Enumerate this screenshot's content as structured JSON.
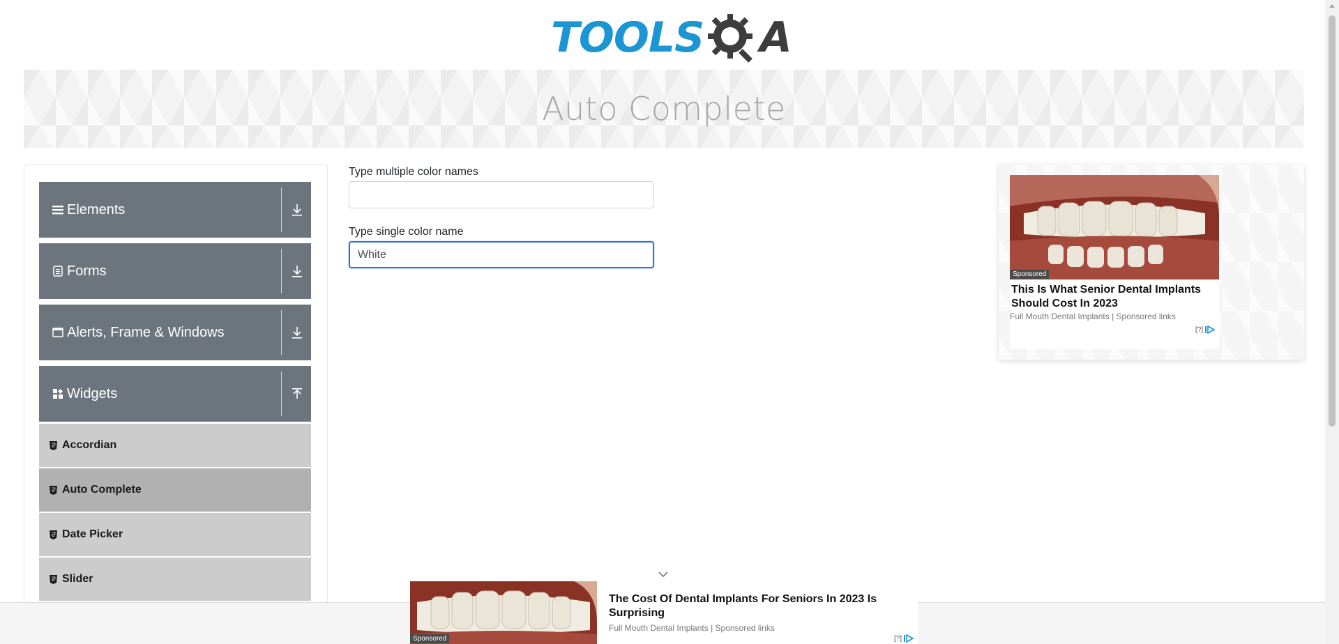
{
  "logo": {
    "part1": "TOOLS",
    "part2": "A"
  },
  "banner": {
    "title": "Auto Complete"
  },
  "sidebar": {
    "groups": [
      {
        "label": "Elements",
        "icon": "menu-bars-icon",
        "state": "collapsed"
      },
      {
        "label": "Forms",
        "icon": "form-doc-icon",
        "state": "collapsed"
      },
      {
        "label": "Alerts, Frame & Windows",
        "icon": "window-icon",
        "state": "collapsed"
      },
      {
        "label": "Widgets",
        "icon": "widgets-grid-icon",
        "state": "expanded"
      }
    ],
    "items": [
      {
        "label": "Accordian",
        "active": false
      },
      {
        "label": "Auto Complete",
        "active": true
      },
      {
        "label": "Date Picker",
        "active": false
      },
      {
        "label": "Slider",
        "active": false
      }
    ]
  },
  "form": {
    "multiple": {
      "label": "Type multiple color names",
      "value": ""
    },
    "single": {
      "label": "Type single color name",
      "value": "White"
    }
  },
  "ad_right": {
    "sponsored": "Sponsored",
    "headline": "This Is What Senior Dental Implants Should Cost In 2023",
    "source": "Full Mouth Dental Implants | Sponsored links",
    "choice": "[?]"
  },
  "ad_bottom": {
    "sponsored": "Sponsored",
    "headline": "The Cost Of Dental Implants For Seniors In 2023 Is Surprising",
    "source": "Full Mouth Dental Implants | Sponsored links",
    "choice": "[?]"
  },
  "colors": {
    "accent": "#1b95d4",
    "group_bg": "#6c757d",
    "item_bg": "#cccccc",
    "item_active": "#b1b1b1",
    "focus": "#2f6fd6"
  }
}
